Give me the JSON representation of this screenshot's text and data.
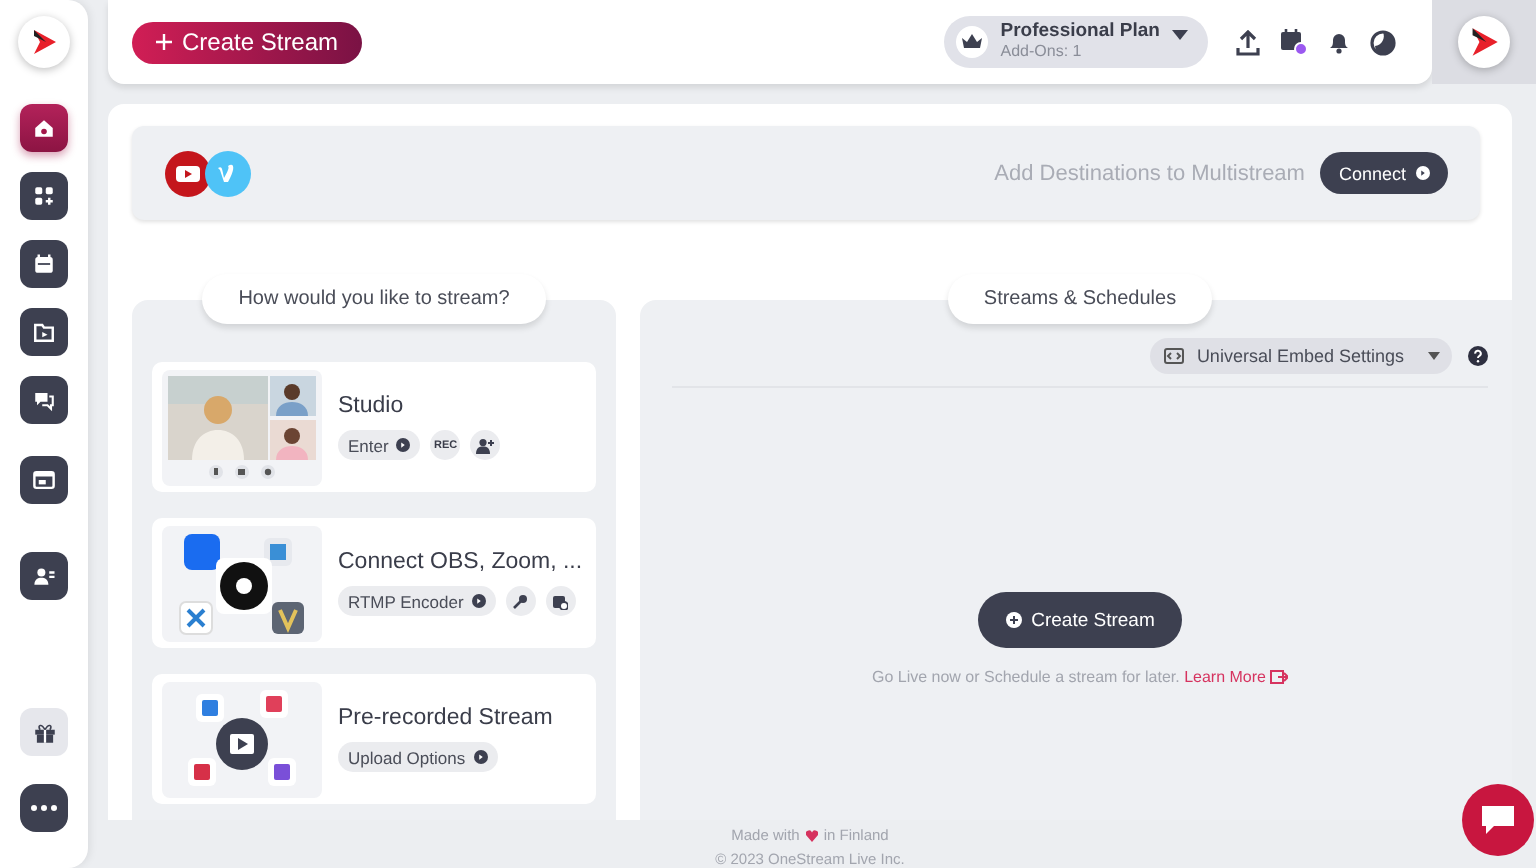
{
  "sidebar": {
    "items": [
      {
        "selected": true
      },
      {
        "selected": false
      },
      {
        "selected": false
      },
      {
        "selected": false
      },
      {
        "selected": false
      },
      {
        "selected": false
      },
      {
        "selected": false
      }
    ]
  },
  "topbar": {
    "create_button": "Create Stream",
    "plan": {
      "name": "Professional Plan",
      "addons": "Add-Ons: 1"
    }
  },
  "destinations": {
    "prompt": "Add Destinations to Multistream",
    "button": "Connect"
  },
  "stream_methods": {
    "title": "How would you like to stream?",
    "options": [
      {
        "kind": "studio",
        "title": "Studio",
        "action": "Enter",
        "badge": "REC"
      },
      {
        "kind": "encoder",
        "title": "Connect OBS, Zoom, ...",
        "action": "RTMP Encoder"
      },
      {
        "kind": "upload",
        "title": "Pre-recorded Stream",
        "action": "Upload Options"
      }
    ]
  },
  "streams": {
    "title": "Streams & Schedules",
    "embed_button": "Universal Embed Settings",
    "create_button": "Create Stream",
    "hint": "Go Live now or Schedule a stream for later.",
    "link": "Learn More"
  },
  "footer": {
    "made_with": "Made with",
    "in_finland": "in Finland",
    "copyright": "© 2023 OneStream Live Inc."
  }
}
